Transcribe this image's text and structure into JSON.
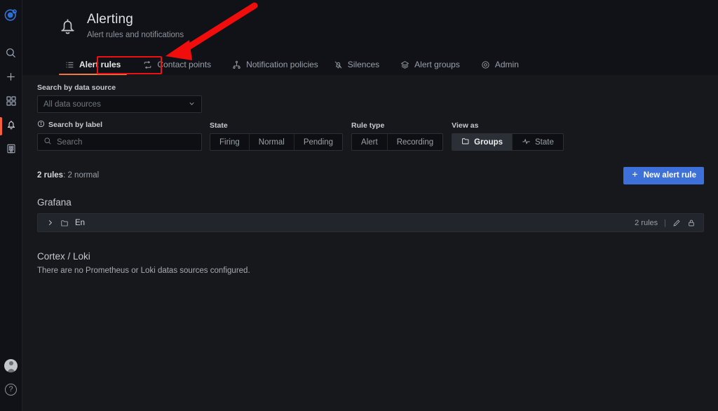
{
  "sidebar": {
    "logo": "grafana-logo",
    "items": [
      {
        "name": "search",
        "icon": "search-icon"
      },
      {
        "name": "create",
        "icon": "plus-icon"
      },
      {
        "name": "dashboards",
        "icon": "grid-icon"
      },
      {
        "name": "alerting",
        "icon": "bell-icon",
        "active": true
      },
      {
        "name": "apps",
        "icon": "building-icon"
      }
    ],
    "bottom": [
      {
        "name": "profile",
        "icon": "user-avatar"
      },
      {
        "name": "help",
        "icon": "help-icon",
        "glyph": "?"
      }
    ]
  },
  "header": {
    "icon": "bell-icon",
    "title": "Alerting",
    "subtitle": "Alert rules and notifications"
  },
  "tabs": [
    {
      "label": "Alert rules",
      "icon": "list-icon",
      "active": true
    },
    {
      "label": "Contact points",
      "icon": "contact-points-icon",
      "active": false
    },
    {
      "label": "Notification policies",
      "icon": "sitemap-icon",
      "active": false
    },
    {
      "label": "Silences",
      "icon": "bell-slash-icon",
      "active": false
    },
    {
      "label": "Alert groups",
      "icon": "layer-group-icon",
      "active": false
    },
    {
      "label": "Admin",
      "icon": "target-icon",
      "active": false
    }
  ],
  "filters": {
    "datasource_label": "Search by data source",
    "datasource_value": "All data sources",
    "label_search_label": "Search by label",
    "label_search_placeholder": "Search",
    "state_label": "State",
    "state_options": [
      "Firing",
      "Normal",
      "Pending"
    ],
    "state_selected": null,
    "rule_type_label": "Rule type",
    "rule_type_options": [
      "Alert",
      "Recording"
    ],
    "rule_type_selected": null,
    "view_as_label": "View as",
    "view_as_options": [
      {
        "label": "Groups",
        "icon": "folder-icon"
      },
      {
        "label": "State",
        "icon": "heart-rate-icon"
      }
    ],
    "view_as_selected": "Groups"
  },
  "summary": {
    "count_bold": "2 rules",
    "count_rest": ": 2 normal",
    "new_rule_button": "New alert rule",
    "new_rule_icon": "plus-icon"
  },
  "grafana_section": {
    "title": "Grafana",
    "rows": [
      {
        "expand_icon": "chevron-right-icon",
        "folder_icon": "folder-icon",
        "name": "En",
        "rules_text": "2 rules",
        "separator": "|",
        "edit_icon": "pencil-icon",
        "lock_icon": "lock-icon"
      }
    ]
  },
  "cortex_section": {
    "title": "Cortex / Loki",
    "empty_message": "There are no Prometheus or Loki datas sources configured."
  },
  "annotations": {
    "highlight_color": "#ee1111",
    "arrow_color": "#f20d0d",
    "highlight_target": "Contact points"
  },
  "colors": {
    "accent_orange": "#f2703c",
    "primary_blue": "#3d71d9",
    "page_bg": "#16181c",
    "header_bg": "#111217"
  }
}
